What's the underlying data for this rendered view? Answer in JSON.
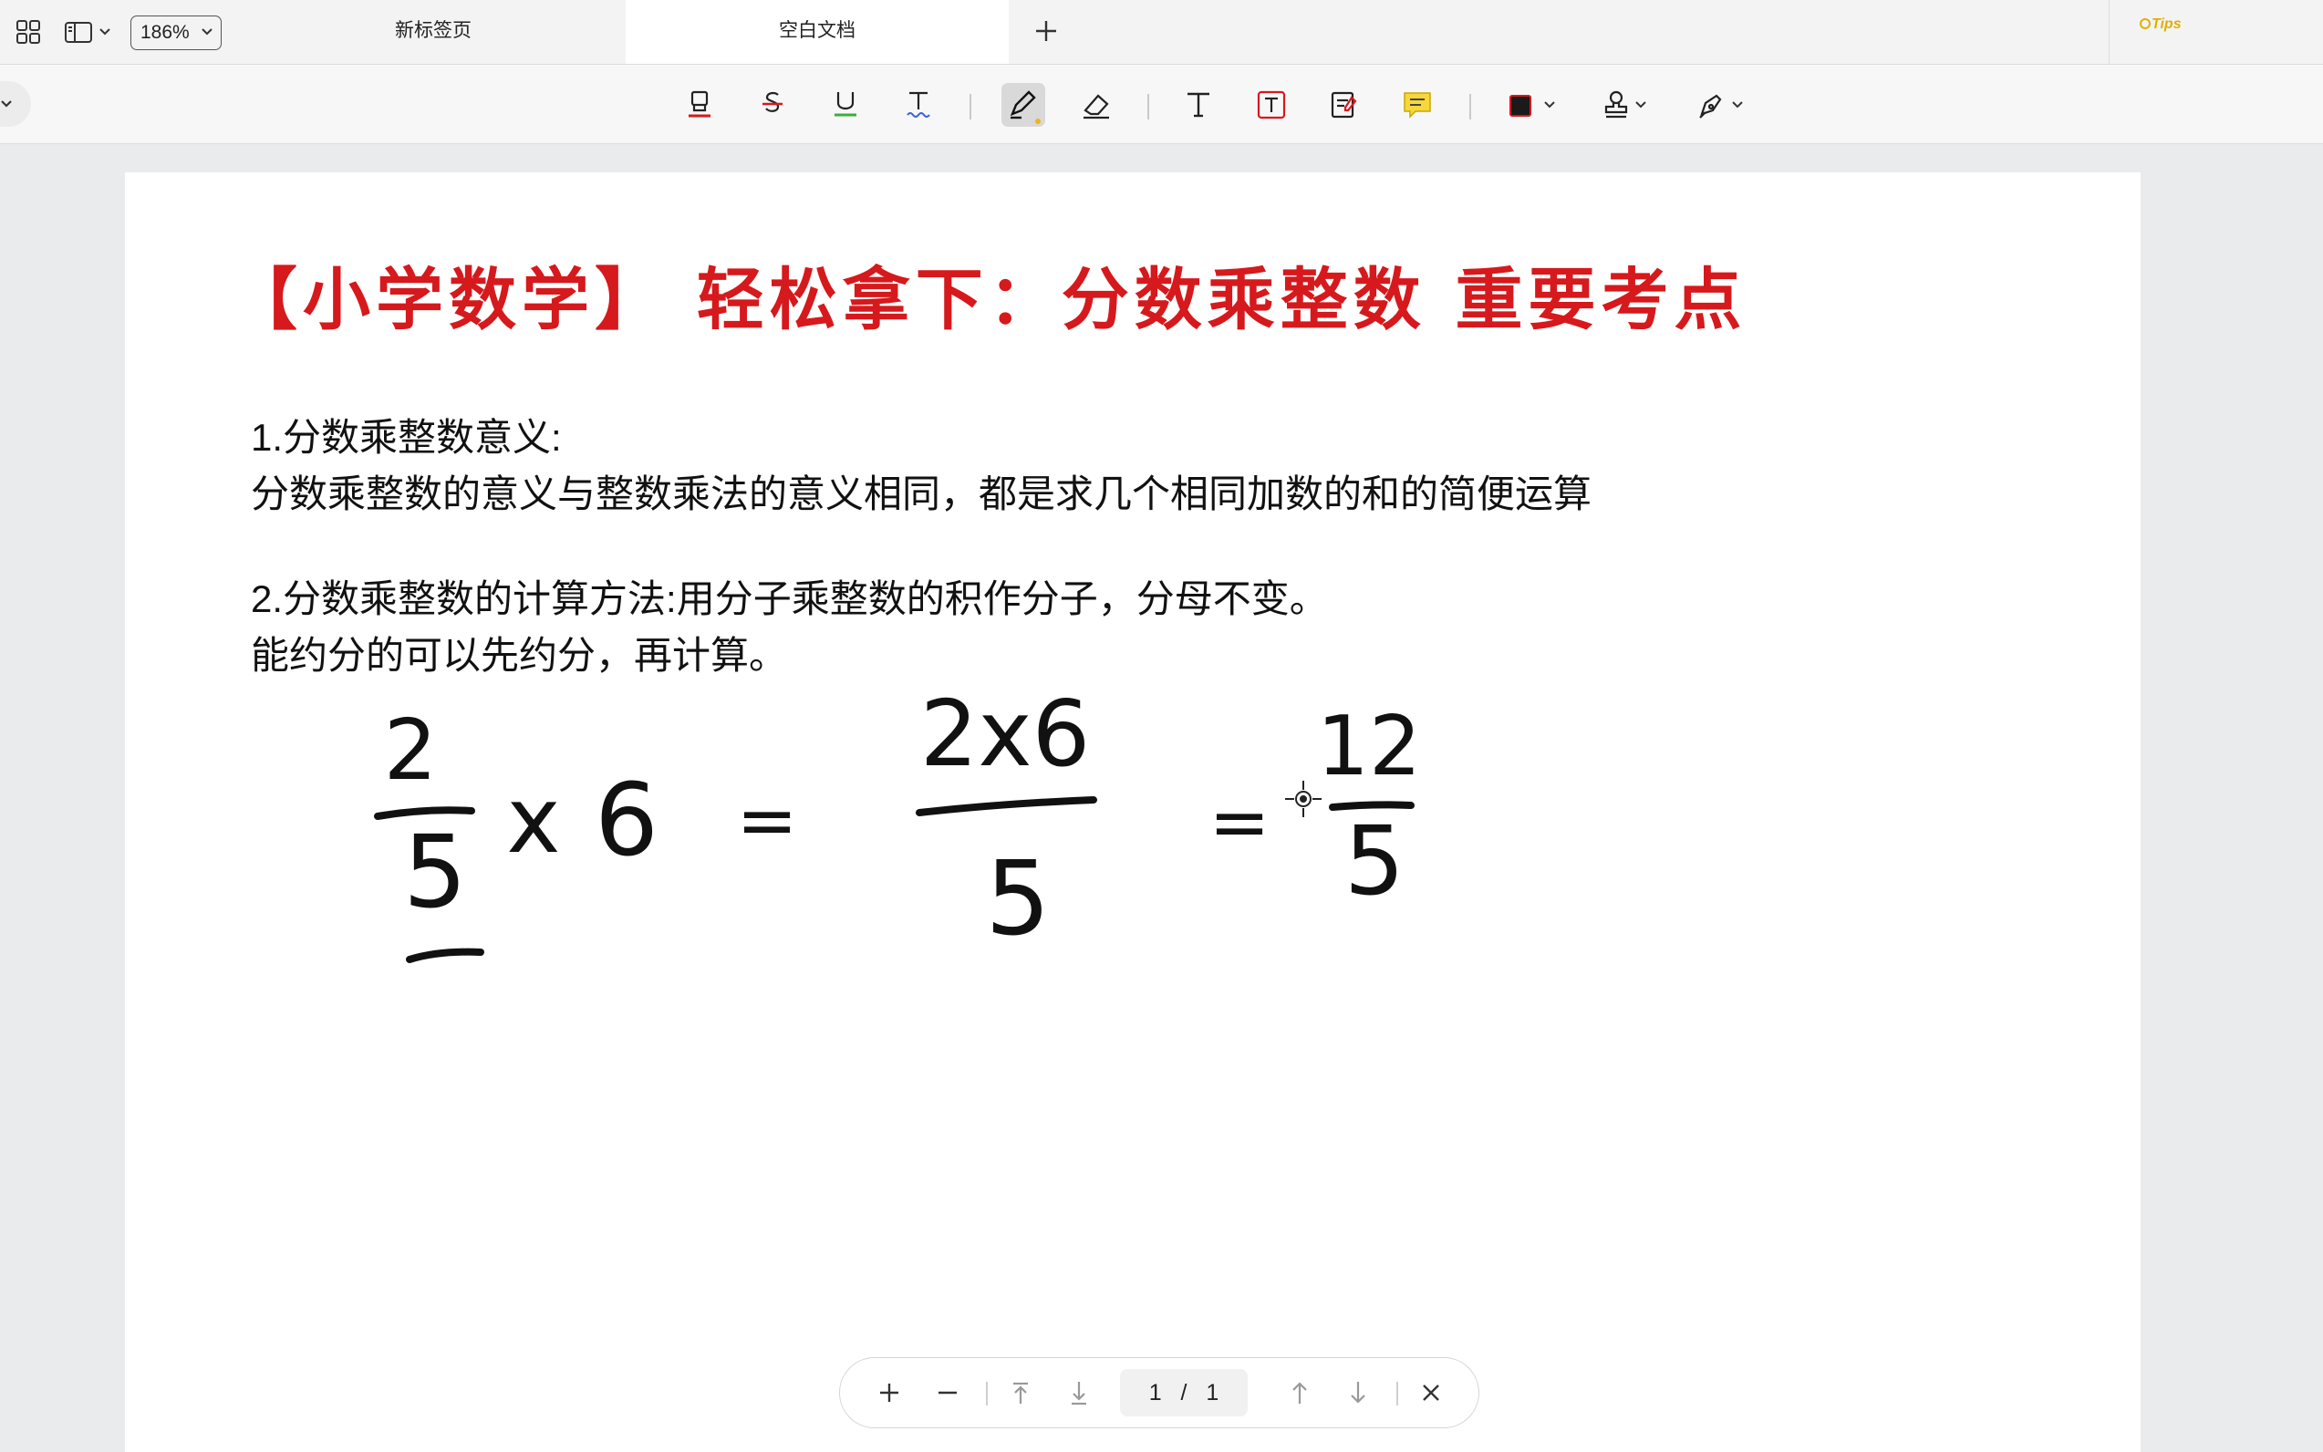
{
  "window": {
    "zoom": "186%",
    "tabs": [
      {
        "label": "新标签页",
        "active": false
      },
      {
        "label": "空白文档",
        "active": true
      }
    ],
    "tips_logo": "Tips"
  },
  "toolbar": {
    "tools": [
      "highlight-text-icon",
      "strikethrough-icon",
      "underline-icon",
      "squiggly-text-icon",
      "pen-icon",
      "eraser-icon",
      "text-icon",
      "textbox-icon",
      "note-icon",
      "comment-icon",
      "color-swatch",
      "stamp-icon",
      "signature-icon"
    ],
    "active_color": "#1a1a1a",
    "accent_color": "#d6191c"
  },
  "document": {
    "title": "【小学数学】 轻松拿下：分数乘整数 重要考点",
    "para1_line1": "1.分数乘整数意义:",
    "para1_line2": "分数乘整数的意义与整数乘法的意义相同，都是求几个相同加数的和的简便运算",
    "para2_line1": "2.分数乘整数的计算方法:用分子乘整数的积作分子，分母不变。",
    "para2_line2": "能约分的可以先约分，再计算。",
    "handwriting": {
      "term1_num": "2",
      "term1_den": "5",
      "times": "x",
      "multiplier": "6",
      "eq": "=",
      "term2_num": "2x6",
      "term2_den": "5",
      "result_num": "12",
      "result_den": "5"
    }
  },
  "findbar": {
    "current_page": "1",
    "separator": "/",
    "total_pages": "1"
  }
}
